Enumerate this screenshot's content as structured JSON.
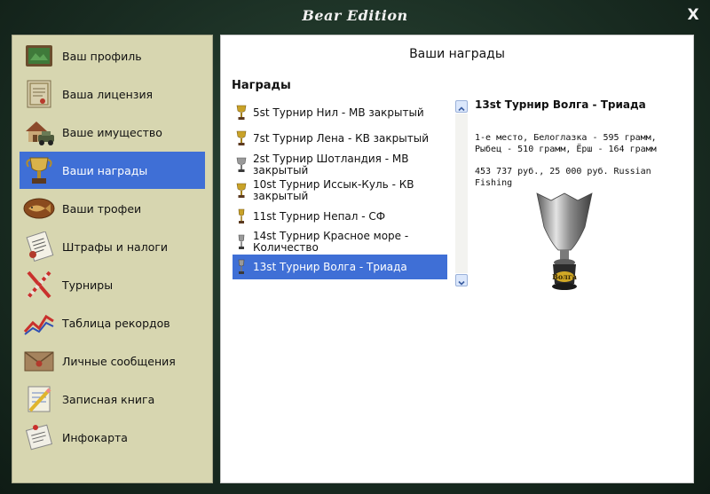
{
  "window": {
    "title": "Bear Edition",
    "close_label": "X"
  },
  "sidebar": {
    "items": [
      {
        "label": "Ваш профиль",
        "icon": "profile-board-icon"
      },
      {
        "label": "Ваша лицензия",
        "icon": "license-certificate-icon"
      },
      {
        "label": "Ваше имущество",
        "icon": "property-house-car-icon"
      },
      {
        "label": "Ваши награды",
        "icon": "trophy-icon",
        "selected": true
      },
      {
        "label": "Ваши трофеи",
        "icon": "fish-plaque-icon"
      },
      {
        "label": "Штрафы и налоги",
        "icon": "fines-document-icon"
      },
      {
        "label": "Турниры",
        "icon": "tournament-flags-icon"
      },
      {
        "label": "Таблица рекордов",
        "icon": "records-chart-icon"
      },
      {
        "label": "Личные сообщения",
        "icon": "envelope-icon"
      },
      {
        "label": "Записная книга",
        "icon": "notebook-pencil-icon"
      },
      {
        "label": "Инфокарта",
        "icon": "info-card-icon"
      }
    ]
  },
  "main": {
    "title": "Ваши награды",
    "list_title": "Награды",
    "awards": [
      {
        "text": "5st Турнир Нил - МВ закрытый",
        "cup": "gold"
      },
      {
        "text": "7st Турнир Лена - КВ закрытый",
        "cup": "gold"
      },
      {
        "text": "2st Турнир Шотландия - МВ закрытый",
        "cup": "silver"
      },
      {
        "text": "10st Турнир Иссык-Куль - КВ закрытый",
        "cup": "gold"
      },
      {
        "text": "11st Турнир Непал - СФ",
        "cup": "gold"
      },
      {
        "text": "14st Турнир Красное море - Количество",
        "cup": "silver"
      },
      {
        "text": "13st Турнир Волга - Триада",
        "cup": "silver",
        "selected": true
      }
    ],
    "detail": {
      "title": "13st Турнир Волга - Триада",
      "result": "1-е место, Белоглазка - 595 грамм, Рыбец - 510 грамм, Ёрш - 164 грамм",
      "prize": "453 737 руб., 25 000 руб. Russian Fishing",
      "trophy_icon": "volga-trophy-cup-icon",
      "trophy_label": "Волга"
    }
  },
  "colors": {
    "selection": "#3f6fd6",
    "sidebar_bg": "#d7d6b0",
    "background": "#1b2f24",
    "gold_cup": "#c9a227",
    "silver_cup": "#9a9a9a"
  }
}
